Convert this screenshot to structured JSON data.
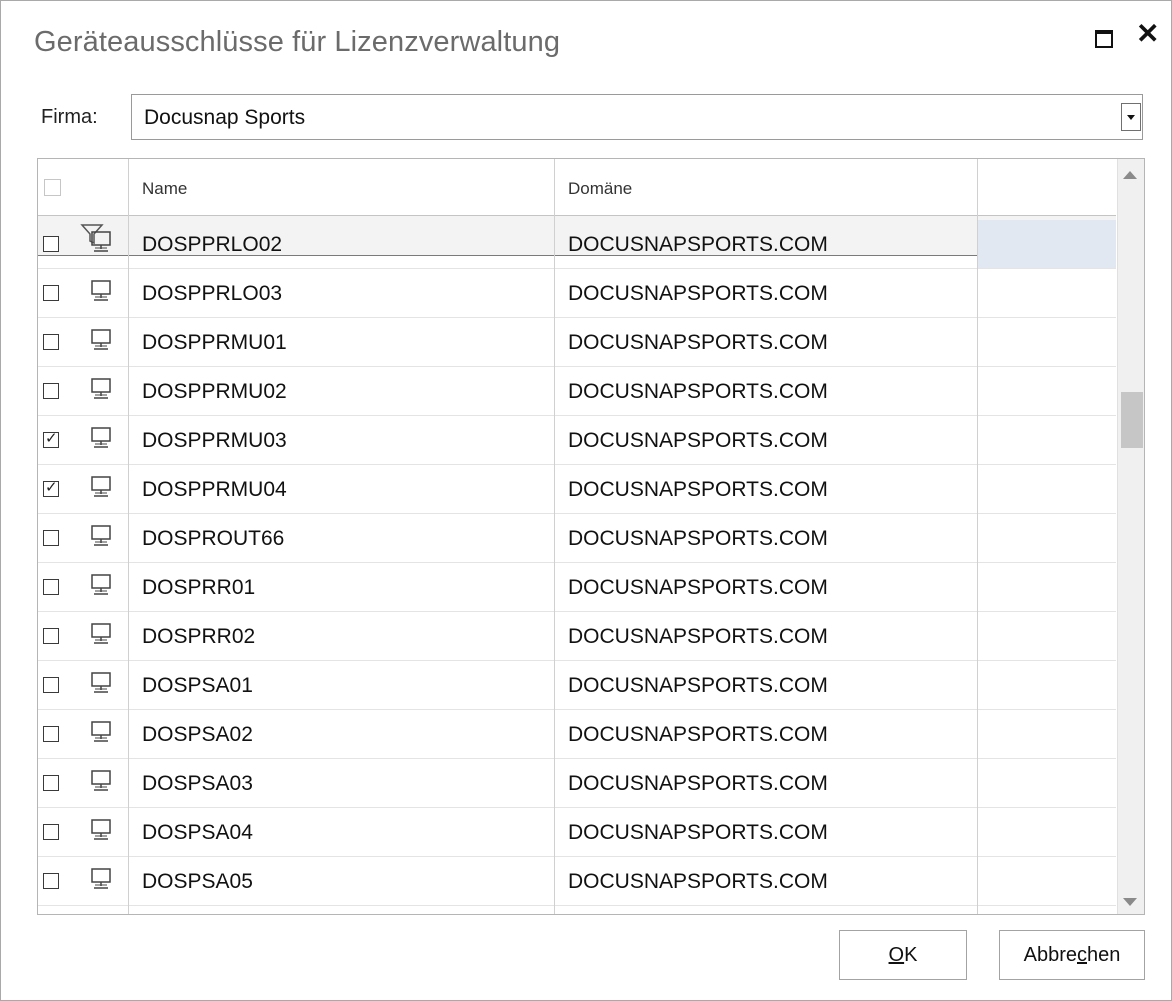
{
  "window": {
    "title": "Geräteausschlüsse für Lizenzverwaltung"
  },
  "firma": {
    "label": "Firma:",
    "value": "Docusnap Sports"
  },
  "grid": {
    "columns": [
      "Name",
      "Domäne"
    ],
    "rows": [
      {
        "checked": false,
        "name": "DOSPPRLO02",
        "domain": "DOCUSNAPSPORTS.COM",
        "selected": true
      },
      {
        "checked": false,
        "name": "DOSPPRLO03",
        "domain": "DOCUSNAPSPORTS.COM"
      },
      {
        "checked": false,
        "name": "DOSPPRMU01",
        "domain": "DOCUSNAPSPORTS.COM"
      },
      {
        "checked": false,
        "name": "DOSPPRMU02",
        "domain": "DOCUSNAPSPORTS.COM"
      },
      {
        "checked": true,
        "name": "DOSPPRMU03",
        "domain": "DOCUSNAPSPORTS.COM"
      },
      {
        "checked": true,
        "name": "DOSPPRMU04",
        "domain": "DOCUSNAPSPORTS.COM"
      },
      {
        "checked": false,
        "name": "DOSPROUT66",
        "domain": "DOCUSNAPSPORTS.COM"
      },
      {
        "checked": false,
        "name": "DOSPRR01",
        "domain": "DOCUSNAPSPORTS.COM"
      },
      {
        "checked": false,
        "name": "DOSPRR02",
        "domain": "DOCUSNAPSPORTS.COM"
      },
      {
        "checked": false,
        "name": "DOSPSA01",
        "domain": "DOCUSNAPSPORTS.COM"
      },
      {
        "checked": false,
        "name": "DOSPSA02",
        "domain": "DOCUSNAPSPORTS.COM"
      },
      {
        "checked": false,
        "name": "DOSPSA03",
        "domain": "DOCUSNAPSPORTS.COM"
      },
      {
        "checked": false,
        "name": "DOSPSA04",
        "domain": "DOCUSNAPSPORTS.COM"
      },
      {
        "checked": false,
        "name": "DOSPSA05",
        "domain": "DOCUSNAPSPORTS.COM"
      }
    ]
  },
  "buttons": {
    "ok": {
      "before": "",
      "accel": "O",
      "after": "K"
    },
    "cancel": {
      "before": "Abbre",
      "accel": "c",
      "after": "hen"
    }
  },
  "colors": {
    "selected_cell": "#e2e8f2",
    "filter_row": "#f3f3f3"
  },
  "icons": {
    "row": "computer-icon",
    "filter": "funnel-icon"
  }
}
